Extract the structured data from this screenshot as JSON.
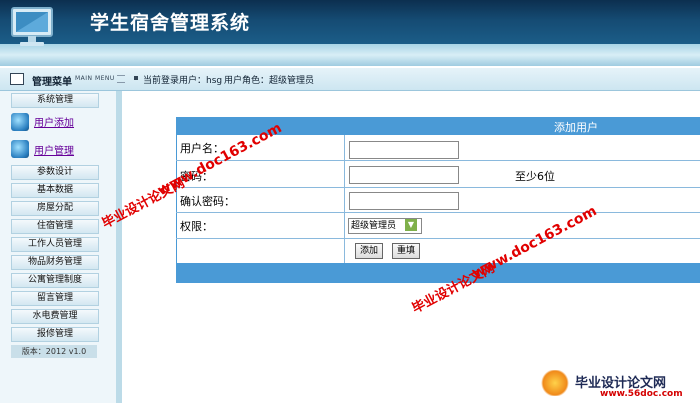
{
  "header": {
    "title": "学生宿舍管理系统"
  },
  "infobar": {
    "menu_label": "管理菜单",
    "menu_sub": "MAIN MENU",
    "login_label": "当前登录用户：hsg",
    "role_label": "用户角色：超级管理员"
  },
  "sidebar": {
    "items": [
      {
        "label": "系统管理"
      },
      {
        "label": "用户添加"
      },
      {
        "label": "用户管理"
      },
      {
        "label": "参数设计"
      },
      {
        "label": "基本数据"
      },
      {
        "label": "房屋分配"
      },
      {
        "label": "住宿管理"
      },
      {
        "label": "工作人员管理"
      },
      {
        "label": "物品财务管理"
      },
      {
        "label": "公寓管理制度"
      },
      {
        "label": "留言管理"
      },
      {
        "label": "水电费管理"
      },
      {
        "label": "报修管理"
      }
    ],
    "version": "版本：2012 v1.0"
  },
  "form": {
    "title": "添加用户",
    "fields": [
      {
        "label": "用户名：",
        "value": ""
      },
      {
        "label": "密码：",
        "value": "",
        "hint": "至少6位"
      },
      {
        "label": "确认密码：",
        "value": ""
      },
      {
        "label": "权限：",
        "value": "超级管理员"
      }
    ],
    "submit_label": "添加",
    "reset_label": "重填"
  },
  "watermarks": {
    "w1": "毕业设计论文网",
    "w2": "www.doc163.com",
    "w3": "毕业设计论文网",
    "w4": "www.doc163.com",
    "brand": "毕业设计论文网",
    "brand_url": "www.56doc.com"
  }
}
